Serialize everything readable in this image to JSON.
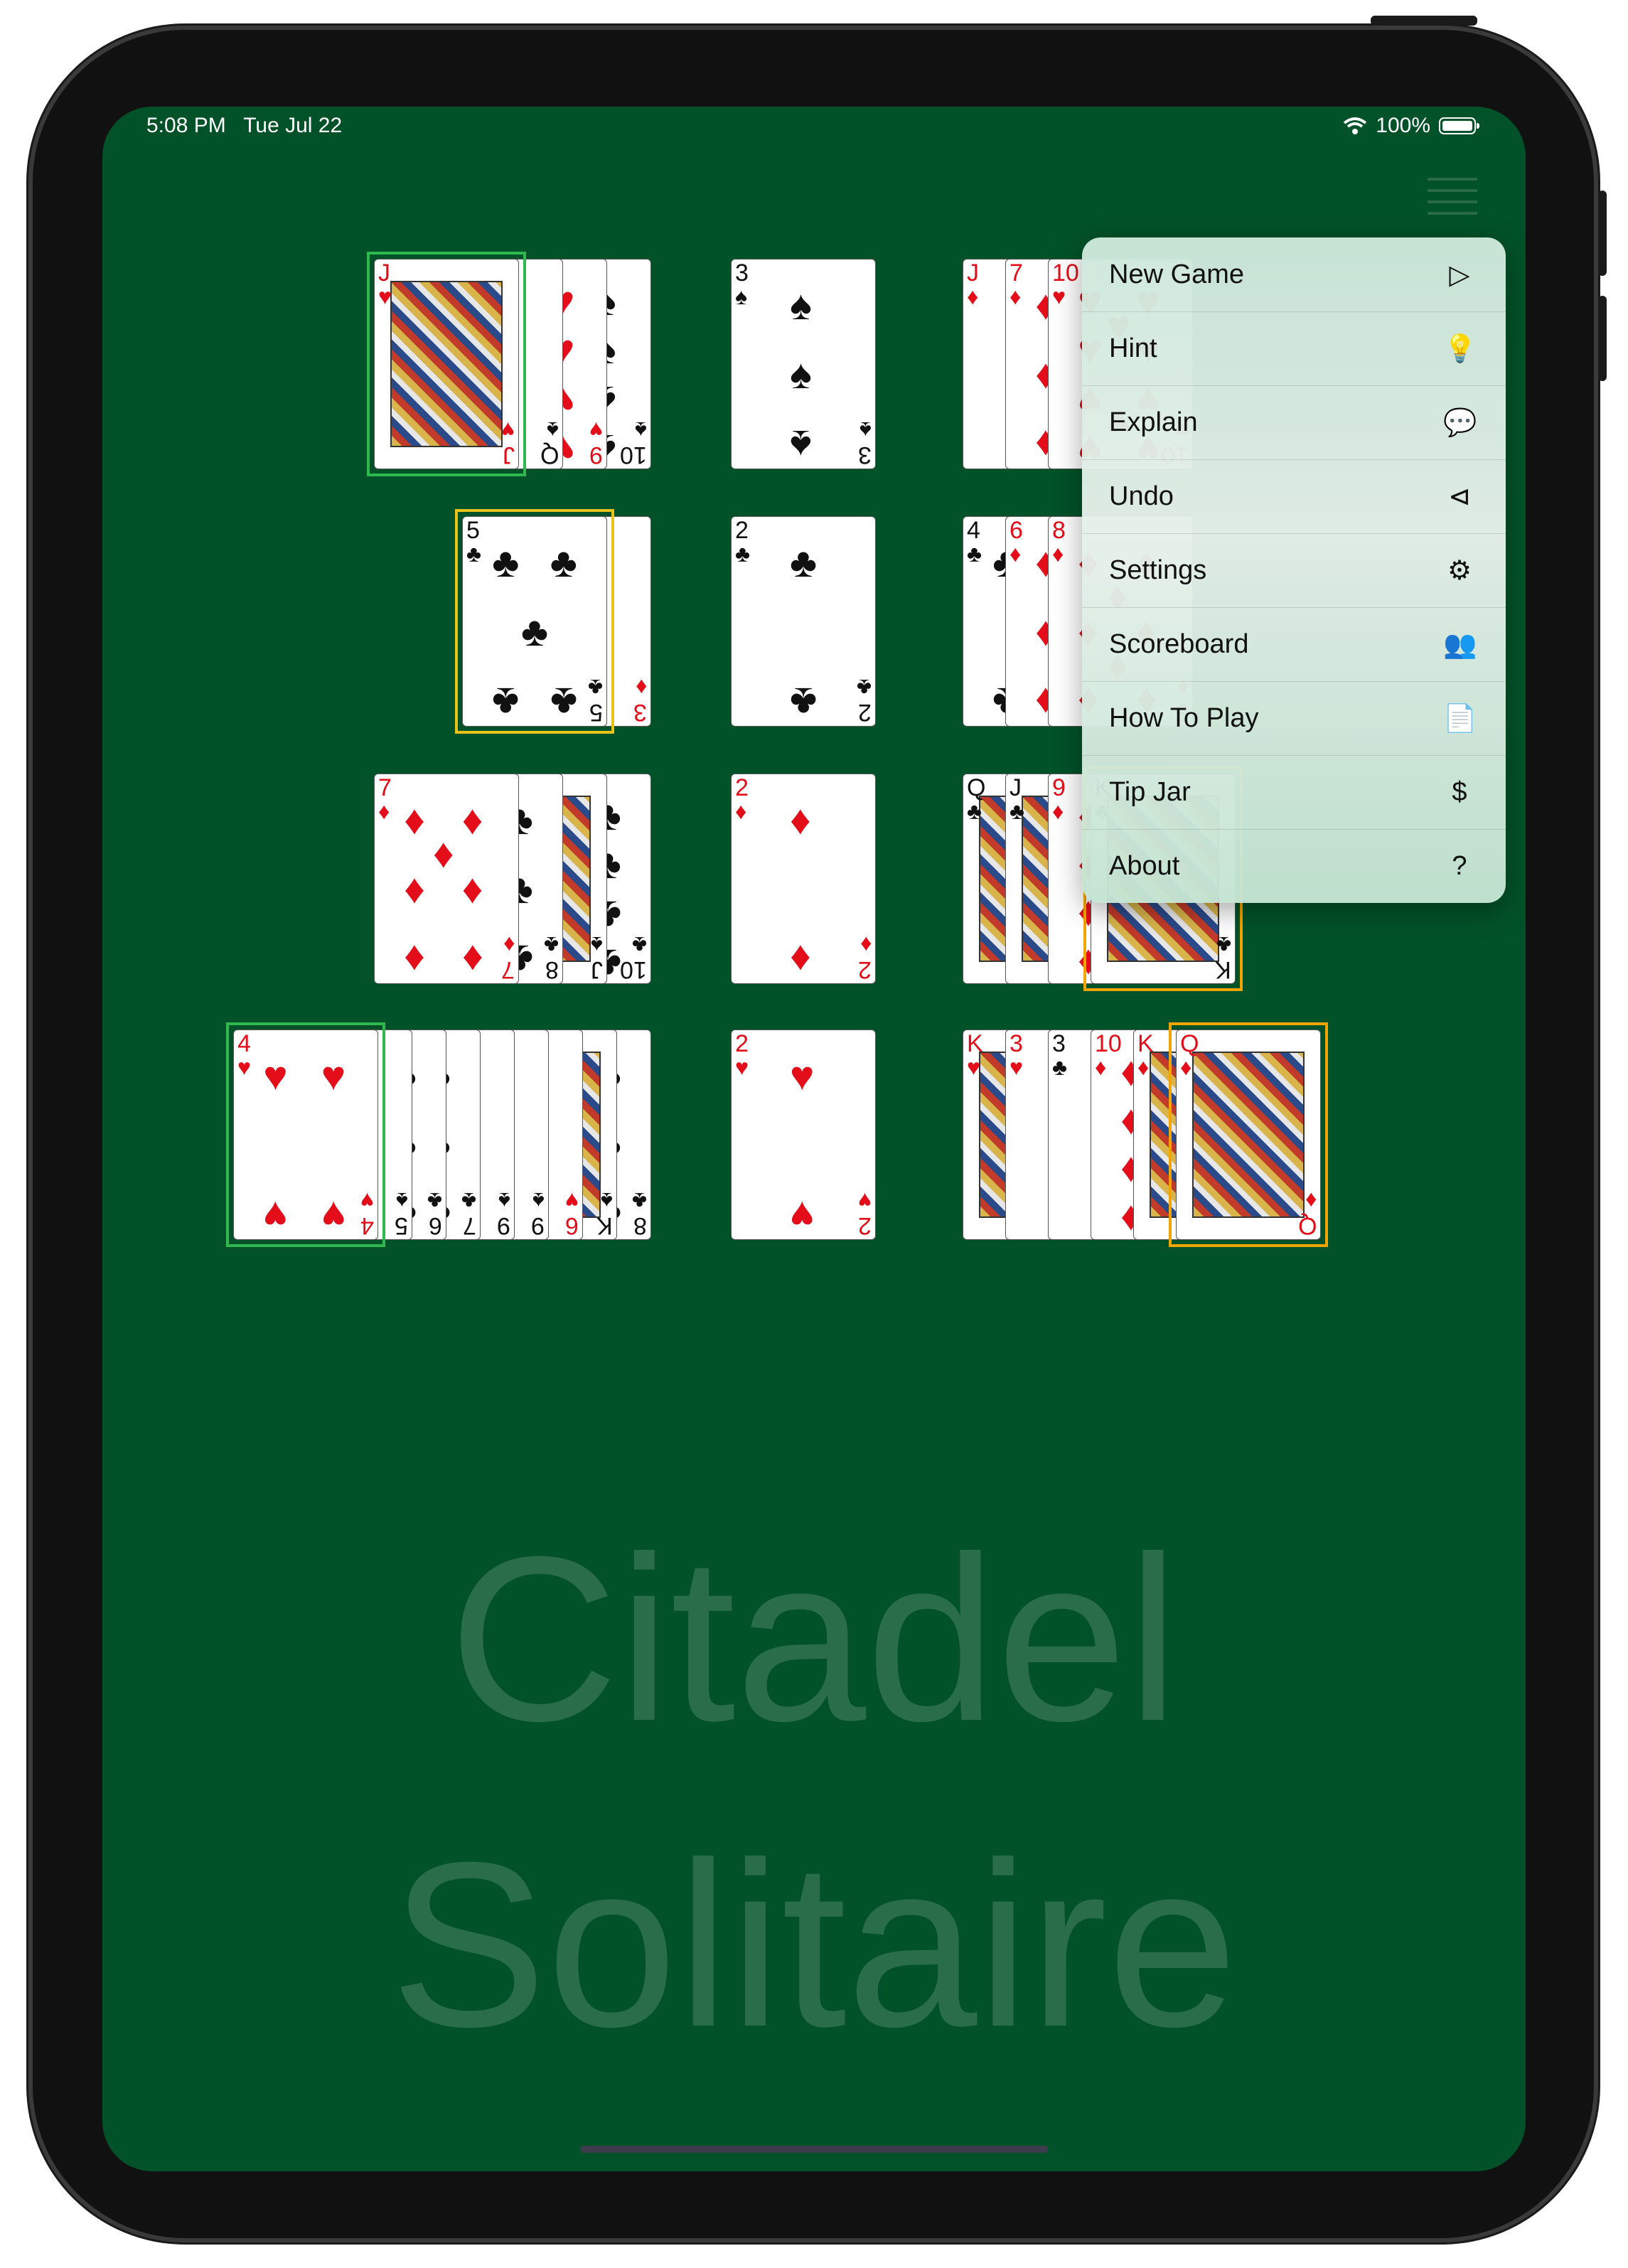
{
  "status_bar": {
    "time": "5:08 PM",
    "date": "Tue Jul 22",
    "battery": "100%"
  },
  "menu": {
    "items": [
      {
        "label": "New Game",
        "icon": "play-icon",
        "glyph": "▷"
      },
      {
        "label": "Hint",
        "icon": "lightbulb-icon",
        "glyph": "💡"
      },
      {
        "label": "Explain",
        "icon": "speech-bubble-icon",
        "glyph": "💬"
      },
      {
        "label": "Undo",
        "icon": "step-back-icon",
        "glyph": "⊲"
      },
      {
        "label": "Settings",
        "icon": "gear-icon",
        "glyph": "⚙"
      },
      {
        "label": "Scoreboard",
        "icon": "people-icon",
        "glyph": "👥"
      },
      {
        "label": "How To Play",
        "icon": "book-icon",
        "glyph": "📄"
      },
      {
        "label": "Tip Jar",
        "icon": "dollar-icon",
        "glyph": "$"
      },
      {
        "label": "About",
        "icon": "question-icon",
        "glyph": "?"
      }
    ]
  },
  "watermark": {
    "line1": "Citadel",
    "line2": "Solitaire"
  },
  "colors": {
    "felt": "#025229",
    "red_suit": "#e30e1a",
    "black_suit": "#111111",
    "hint_green": "#2fb84f",
    "hint_yellow": "#e8c41a",
    "hint_orange": "#f2a400"
  },
  "tableau": {
    "rows": [
      {
        "left": [
          {
            "r": "10",
            "s": "♠"
          },
          {
            "r": "9",
            "s": "♥"
          },
          {
            "r": "Q",
            "s": "♠"
          },
          {
            "r": "J",
            "s": "♥",
            "face": true
          }
        ],
        "foundation": {
          "r": "3",
          "s": "♠"
        },
        "right": [
          {
            "r": "J",
            "s": "♦"
          },
          {
            "r": "7",
            "s": "♦"
          },
          {
            "r": "10",
            "s": "♥"
          }
        ]
      },
      {
        "left": [
          {
            "r": "3",
            "s": "♦"
          },
          {
            "r": "5",
            "s": "♣"
          }
        ],
        "foundation": {
          "r": "2",
          "s": "♣"
        },
        "right": [
          {
            "r": "4",
            "s": "♣"
          },
          {
            "r": "6",
            "s": "♦"
          },
          {
            "r": "8",
            "s": "♦"
          }
        ]
      },
      {
        "left": [
          {
            "r": "10",
            "s": "♣"
          },
          {
            "r": "J",
            "s": "♠",
            "face": true
          },
          {
            "r": "8",
            "s": "♣"
          },
          {
            "r": "7",
            "s": "♦"
          }
        ],
        "foundation": {
          "r": "2",
          "s": "♦"
        },
        "right": [
          {
            "r": "Q",
            "s": "♣",
            "face": true
          },
          {
            "r": "J",
            "s": "♣",
            "face": true
          },
          {
            "r": "9",
            "s": "♦"
          },
          {
            "r": "K",
            "s": "♣",
            "face": true
          }
        ]
      },
      {
        "left": [
          {
            "r": "8",
            "s": "♣"
          },
          {
            "r": "K",
            "s": "♠",
            "face": true
          },
          {
            "r": "6",
            "s": "♥"
          },
          {
            "r": "9",
            "s": "♠"
          },
          {
            "r": "9",
            "s": "♠"
          },
          {
            "r": "7",
            "s": "♣"
          },
          {
            "r": "6",
            "s": "♣"
          },
          {
            "r": "5",
            "s": "♠"
          },
          {
            "r": "4",
            "s": "♥"
          }
        ],
        "foundation": {
          "r": "2",
          "s": "♥"
        },
        "right": [
          {
            "r": "K",
            "s": "♥",
            "face": true
          },
          {
            "r": "3",
            "s": "♥"
          },
          {
            "r": "3",
            "s": "♣"
          },
          {
            "r": "10",
            "s": "♦"
          },
          {
            "r": "K",
            "s": "♦",
            "face": true
          },
          {
            "r": "Q",
            "s": "♦",
            "face": true
          }
        ]
      }
    ]
  }
}
